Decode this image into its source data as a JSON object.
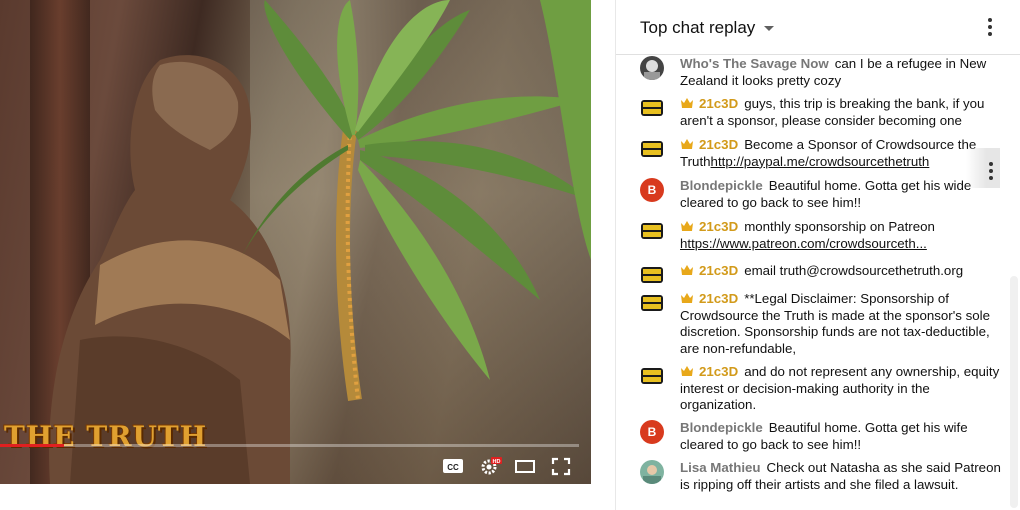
{
  "player": {
    "watermark_text": "THE TRUTH",
    "progress_fraction": 0.11,
    "controls": {
      "captions_label": "CC",
      "hd_badge": "HD"
    }
  },
  "chat": {
    "title": "Top chat replay",
    "messages": [
      {
        "author": "Who's The Savage Now",
        "text": "can I be a refugee in New Zealand it looks pretty cozy",
        "member": false,
        "avatar": "photo-avatar"
      },
      {
        "author": "21c3D",
        "text": "guys, this trip is breaking the bank, if you aren't a sponsor, please consider becoming one",
        "member": true,
        "avatar": "channel-logo"
      },
      {
        "author": "21c3D",
        "text": "Become a Sponsor of Crowdsource the Truth",
        "link": "http://paypal.me/crowdsourcethetruth",
        "member": true,
        "avatar": "channel-logo"
      },
      {
        "author": "Blondepickle",
        "text": "Beautiful home. Gotta get his wide cleared to go back to see him!!",
        "member": false,
        "avatar": "letter-avatar",
        "avatar_letter": "B"
      },
      {
        "author": "21c3D",
        "text": "monthly sponsorship on Patreon ",
        "link": "https://www.patreon.com/crowdsourceth...",
        "member": true,
        "avatar": "channel-logo"
      },
      {
        "author": "21c3D",
        "text": "email truth@crowdsourcethetruth.org",
        "member": true,
        "avatar": "channel-logo"
      },
      {
        "author": "21c3D",
        "text": "**Legal Disclaimer: Sponsorship of Crowdsource the Truth is made at the sponsor's sole discretion. Sponsorship funds are not tax-deductible, are non-refundable,",
        "member": true,
        "avatar": "channel-logo"
      },
      {
        "author": "21c3D",
        "text": "and do not represent any ownership, equity interest or decision-making authority in the organization.",
        "member": true,
        "avatar": "channel-logo"
      },
      {
        "author": "Blondepickle",
        "text": "Beautiful home. Gotta get his wife cleared to go back to see him!!",
        "member": false,
        "avatar": "letter-avatar",
        "avatar_letter": "B"
      },
      {
        "author": "Lisa Mathieu",
        "text": "Check out Natasha as she said Patreon is ripping off their artists and she filed a lawsuit.",
        "member": false,
        "avatar": "photo-avatar"
      }
    ]
  },
  "colors": {
    "member_name": "#d29a1a",
    "author_name": "#777777",
    "progress_played": "#e02020",
    "letter_avatar": "#d83a1e"
  }
}
